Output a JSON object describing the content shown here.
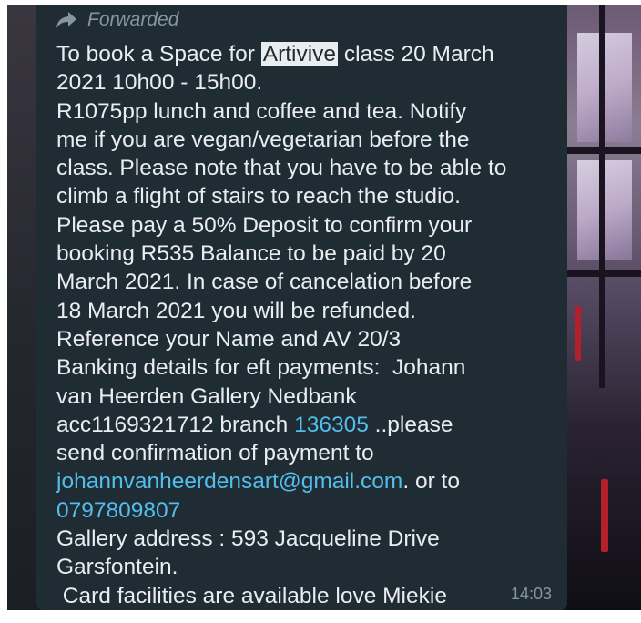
{
  "message": {
    "forwarded_label": "Forwarded",
    "forwarded_icon": "forward-arrow-icon",
    "text": {
      "l1_a": "To book a Space for ",
      "l1_highlight": "Artivive",
      "l1_b": " class 20 March",
      "l2": "2021 10h00 - 15h00.",
      "l3": "R1075pp lunch and coffee and tea. Notify",
      "l4": "me if you are vegan/vegetarian before the",
      "l5": "class. Please note that you have to be able to",
      "l6": "climb a flight of stairs to reach the studio.",
      "l7": "Please pay a 50% Deposit to confirm your",
      "l8": "booking R535 Balance to be paid by 20",
      "l9": "March 2021. In case of cancelation before",
      "l10": "18 March 2021 you will be refunded.",
      "l11": "Reference your Name and AV 20/3",
      "l12": "Banking details for eft payments:  Johann",
      "l13": "van Heerden Gallery Nedbank",
      "l14_a": "acc1169321712 branch ",
      "l14_link": "136305",
      "l14_b": " ..please",
      "l15": "send confirmation of payment to",
      "l16_link": "johannvanheerdensart@gmail.com",
      "l16_b": ". or to",
      "l17_link": "0797809807",
      "l18": "Gallery address : 593 Jacqueline Drive",
      "l19": "Garsfontein.",
      "l20": " Card facilities are available love Miekie"
    },
    "timestamp": "14:03"
  },
  "colors": {
    "bubble_bg": "#1f2c34",
    "text": "#e9edef",
    "muted": "#8696a0",
    "link": "#53bdeb",
    "highlight_bg": "#e9edef"
  }
}
